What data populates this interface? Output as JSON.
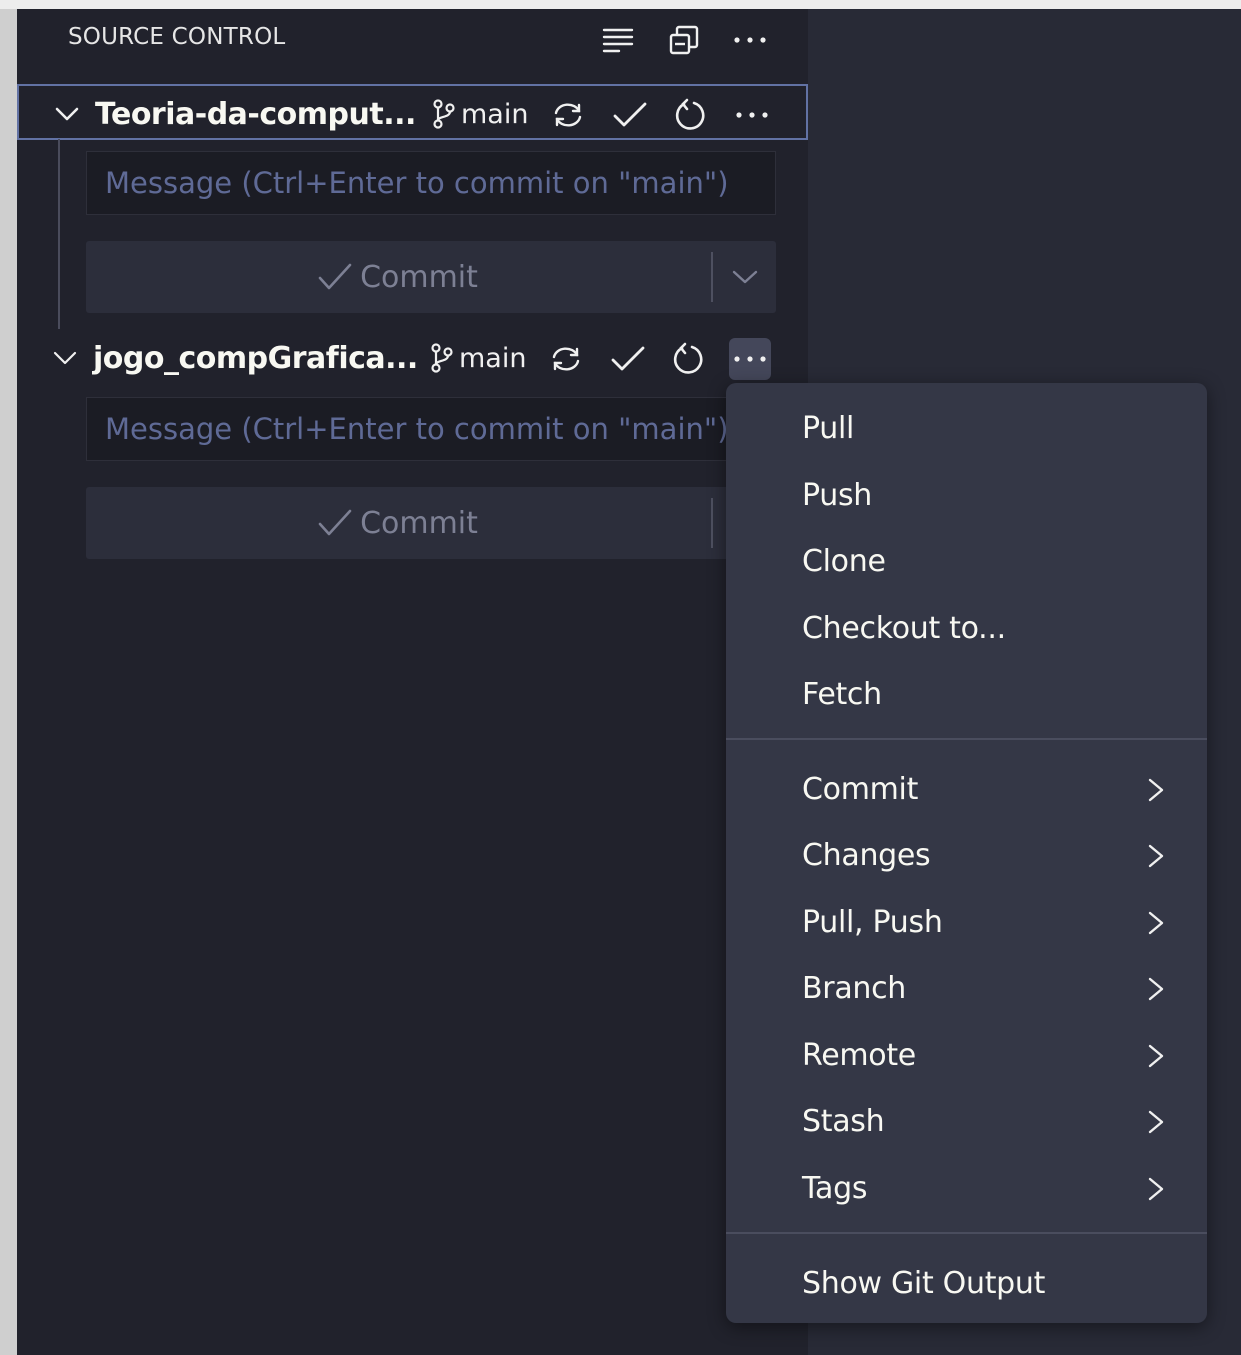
{
  "panel": {
    "title": "SOURCE CONTROL",
    "title_actions": [
      "list-view-icon",
      "collapse-all-icon",
      "more-actions-icon"
    ]
  },
  "repositories": [
    {
      "name": "Teoria-da-comput...",
      "branch": "main",
      "message_placeholder": "Message (Ctrl+Enter to commit on \"main\")",
      "commit_label": "Commit"
    },
    {
      "name": "jogo_compGrafica...",
      "branch": "main",
      "message_placeholder": "Message (Ctrl+Enter to commit on \"main\")",
      "commit_label": "Commit"
    }
  ],
  "menu": {
    "group1": [
      "Pull",
      "Push",
      "Clone",
      "Checkout to...",
      "Fetch"
    ],
    "group2": [
      "Commit",
      "Changes",
      "Pull, Push",
      "Branch",
      "Remote",
      "Stash",
      "Tags"
    ],
    "group3": [
      "Show Git Output"
    ]
  },
  "colors": {
    "panel_bg": "#21222c",
    "menu_bg": "#343746",
    "focus_border": "#6272a4",
    "placeholder": "#5f6a96"
  }
}
